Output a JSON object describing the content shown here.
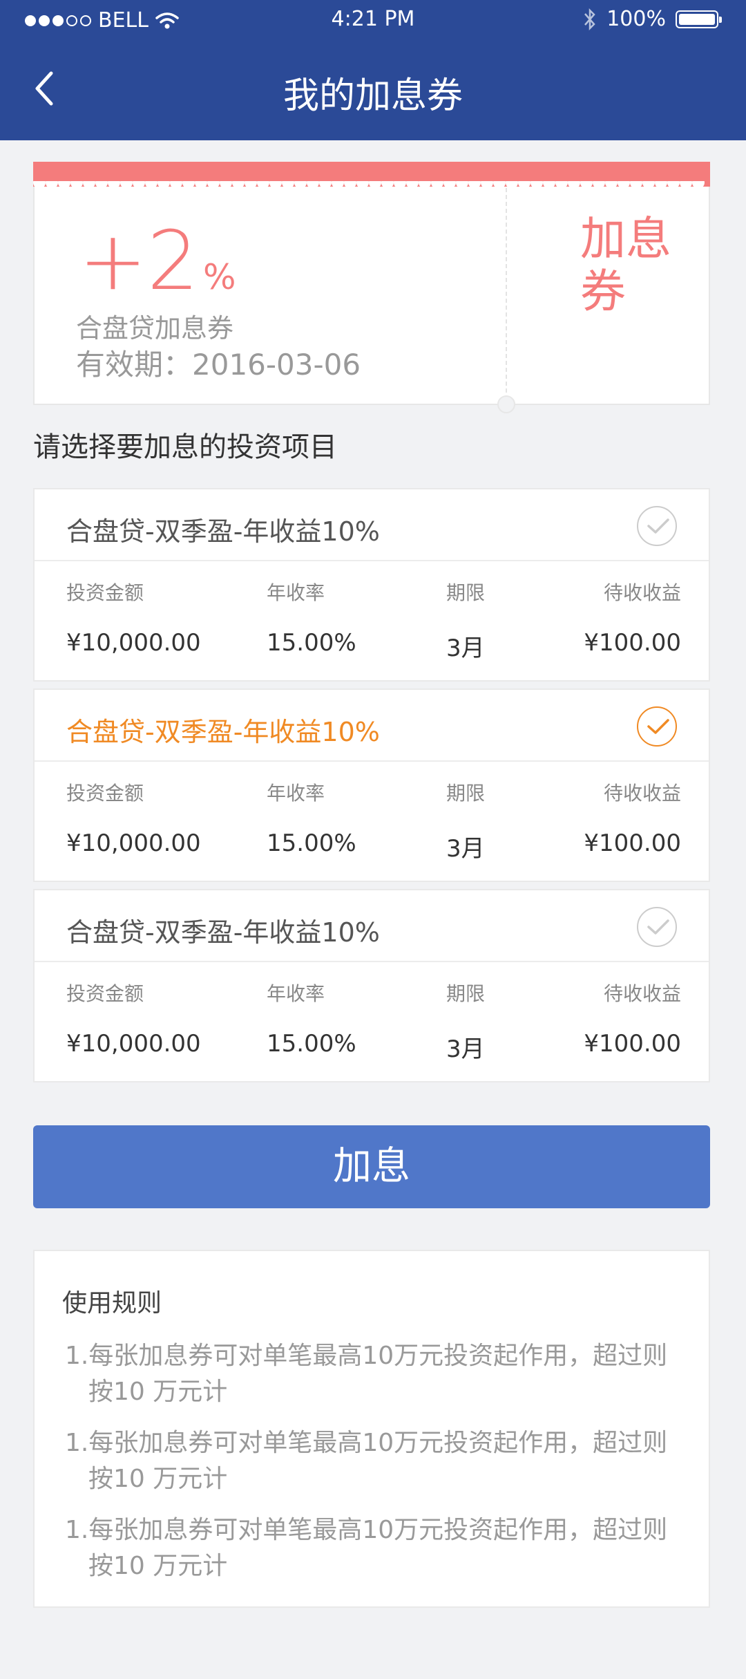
{
  "status_bar": {
    "carrier": "BELL",
    "time": "4:21 PM",
    "battery": "100%"
  },
  "header": {
    "title": "我的加息券"
  },
  "coupon": {
    "rate": "+2",
    "unit": "%",
    "name": "合盘贷加息券",
    "validity": "有效期：2016-03-06",
    "label": "加息券",
    "colors": {
      "accent": "#f47c7c"
    }
  },
  "section_title": "请选择要加息的投资项目",
  "columns": {
    "amount": "投资金额",
    "rate": "年收率",
    "term": "期限",
    "pending": "待收收益"
  },
  "projects": [
    {
      "name": "合盘贷-双季盈-年收益10%",
      "amount": "¥10,000.00",
      "rate": "15.00%",
      "term": "3月",
      "pending": "¥100.00",
      "selected": false
    },
    {
      "name": "合盘贷-双季盈-年收益10%",
      "amount": "¥10,000.00",
      "rate": "15.00%",
      "term": "3月",
      "pending": "¥100.00",
      "selected": true
    },
    {
      "name": "合盘贷-双季盈-年收益10%",
      "amount": "¥10,000.00",
      "rate": "15.00%",
      "term": "3月",
      "pending": "¥100.00",
      "selected": false
    }
  ],
  "button": {
    "label": "加息"
  },
  "rules": {
    "title": "使用规则",
    "items": [
      "1.每张加息券可对单笔最高10万元投资起作用，超过则按10 万元计",
      "1.每张加息券可对单笔最高10万元投资起作用，超过则按10 万元计",
      "1.每张加息券可对单笔最高10万元投资起作用，超过则按10 万元计"
    ]
  },
  "colors": {
    "header": "#2b4a97",
    "button": "#5077c9",
    "selected": "#f08a24"
  }
}
